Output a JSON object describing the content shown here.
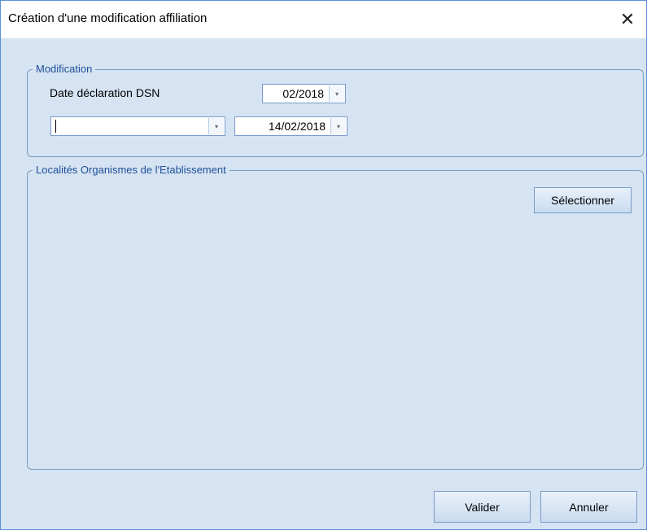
{
  "window": {
    "title": "Création d'une modification affiliation",
    "close_glyph": "✕"
  },
  "modification": {
    "legend": "Modification",
    "date_label": "Date déclaration DSN",
    "period_value": "02/2018",
    "type_value": "",
    "date_value": "14/02/2018",
    "dropdown_arrow": "▾"
  },
  "localites": {
    "legend": "Localités Organismes de l'Etablissement",
    "select_label": "Sélectionner"
  },
  "footer": {
    "validate_label": "Valider",
    "cancel_label": "Annuler"
  }
}
